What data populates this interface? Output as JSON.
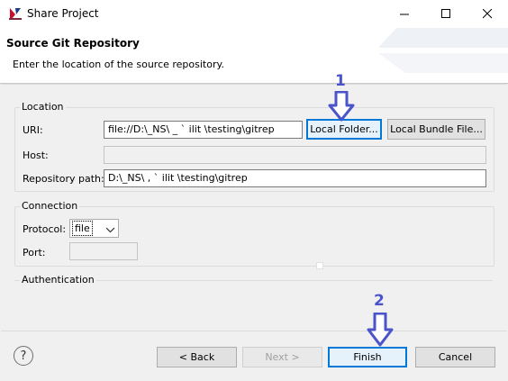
{
  "window": {
    "title": "Share Project"
  },
  "header": {
    "title": "Source Git Repository",
    "description": "Enter the location of the source repository."
  },
  "location": {
    "group_label": "Location",
    "uri_label": "URI:",
    "uri_value": "file://D:\\_NS\\   _  ` ilit \\testing\\gitrep",
    "local_folder_label": "Local Folder...",
    "local_bundle_label": "Local Bundle File...",
    "host_label": "Host:",
    "host_value": "",
    "repo_path_label": "Repository path:",
    "repo_path_value": "D:\\_NS\\     ,  ` ilit \\testing\\gitrep"
  },
  "connection": {
    "group_label": "Connection",
    "protocol_label": "Protocol:",
    "protocol_value": "file",
    "port_label": "Port:",
    "port_value": ""
  },
  "authentication": {
    "group_label": "Authentication"
  },
  "callouts": {
    "one": "1",
    "two": "2"
  },
  "footer": {
    "back_label": "< Back",
    "next_label": "Next >",
    "finish_label": "Finish",
    "cancel_label": "Cancel",
    "help_icon": "?"
  },
  "colors": {
    "accent": "#0078d7",
    "callout": "#4a53c9"
  }
}
